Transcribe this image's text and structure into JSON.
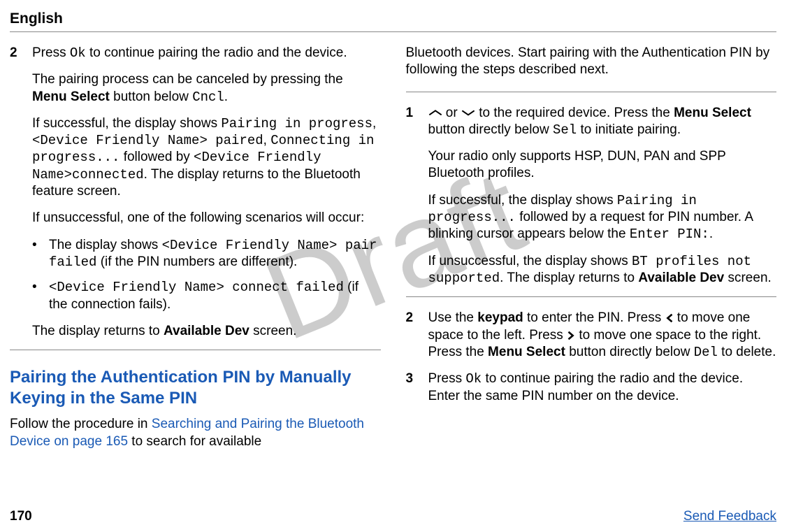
{
  "header": {
    "language": "English"
  },
  "watermark": "Draft",
  "left": {
    "step2": {
      "num": "2",
      "p1a": "Press ",
      "p1_ok": "Ok",
      "p1b": " to continue pairing the radio and the device.",
      "p2a": "The pairing process can be canceled by pressing the ",
      "p2_bold": "Menu Select",
      "p2b": " button below ",
      "p2_cncl": "Cncl",
      "p2c": ".",
      "p3a": "If successful, the display shows ",
      "p3_m1": "Pairing in progress",
      "p3b": ",",
      "p3_m2": "<Device Friendly Name> paired",
      "p3c": ", ",
      "p3_m3": "Connecting in progress...",
      "p3d": " followed by ",
      "p3_m4": "<Device Friendly Name>connected",
      "p3e": ". The display returns to the Bluetooth feature screen.",
      "p4": "If unsuccessful, one of the following scenarios will occur:",
      "b1a": "The display shows ",
      "b1_m": "<Device Friendly Name> pair failed",
      "b1b": " (if the PIN numbers are different).",
      "b2_m": "<Device Friendly Name> connect failed",
      "b2b": " (if the connection fails).",
      "p5a": "The display returns to ",
      "p5_bold": "Available Dev",
      "p5b": " screen."
    },
    "section_title": "Pairing the Authentication PIN by Manually Keying in the Same PIN",
    "intro_a": "Follow the procedure in ",
    "intro_link": "Searching and Pairing the Bluetooth Device on page 165",
    "intro_b": " to search for available"
  },
  "right": {
    "cont": "Bluetooth devices. Start pairing with the Authentication PIN by following the steps described next.",
    "step1": {
      "num": "1",
      "p1a": " or ",
      "p1b": " to the required device. Press the ",
      "p1_bold": "Menu Select",
      "p1c": " button directly below ",
      "p1_sel": "Sel",
      "p1d": " to initiate pairing.",
      "p2": "Your radio only supports HSP, DUN, PAN and SPP Bluetooth profiles.",
      "p3a": "If successful, the display shows ",
      "p3_m1": "Pairing in progress...",
      "p3b": " followed by a request for PIN number. A blinking cursor appears below the ",
      "p3_m2": "Enter PIN:",
      "p3c": ".",
      "p4a": "If unsuccessful, the display shows ",
      "p4_m": "BT profiles not supported",
      "p4b": ". The display returns to ",
      "p4_bold": "Available Dev",
      "p4c": " screen."
    },
    "step2": {
      "num": "2",
      "p1a": "Use the ",
      "p1_bold1": "keypad",
      "p1b": " to enter the PIN. Press ",
      "p1c": " to move one space to the left. Press ",
      "p1d": " to move one space to the right. Press the ",
      "p1_bold2": "Menu Select",
      "p1e": " button directly below ",
      "p1_del": "Del",
      "p1f": " to delete."
    },
    "step3": {
      "num": "3",
      "p1a": "Press ",
      "p1_ok": "Ok",
      "p1b": " to continue pairing the radio and the device. Enter the same PIN number on the device."
    }
  },
  "footer": {
    "page": "170",
    "feedback": "Send Feedback"
  }
}
